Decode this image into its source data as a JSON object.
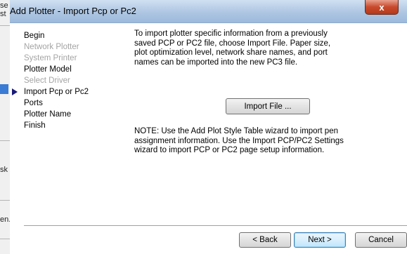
{
  "background_app": {
    "fragments": [
      "se",
      "st",
      "sk",
      "en."
    ]
  },
  "dialog": {
    "title": "Add Plotter - Import Pcp or Pc2",
    "close_label": "x",
    "nav": [
      {
        "label": "Begin",
        "state": "enabled"
      },
      {
        "label": "Network Plotter",
        "state": "disabled"
      },
      {
        "label": "System Printer",
        "state": "disabled"
      },
      {
        "label": "Plotter Model",
        "state": "enabled"
      },
      {
        "label": "Select Driver",
        "state": "disabled"
      },
      {
        "label": "Import Pcp or Pc2",
        "state": "current"
      },
      {
        "label": "Ports",
        "state": "enabled"
      },
      {
        "label": "Plotter Name",
        "state": "enabled"
      },
      {
        "label": "Finish",
        "state": "enabled"
      }
    ],
    "intro_text": "To import plotter specific information from a previously saved PCP or PC2 file, choose Import File. Paper size, plot optimization level, network share names, and port names can be imported into the new PC3 file.",
    "import_button": "Import File ...",
    "note_text": "NOTE: Use the Add Plot Style Table wizard to import pen assignment information. Use the Import PCP/PC2 Settings wizard to import PCP or PC2 page setup information.",
    "buttons": {
      "back": "< Back",
      "next": "Next >",
      "cancel": "Cancel"
    }
  },
  "colors": {
    "titlebar": "#aec6e2",
    "close": "#c84a2c",
    "disabled_text": "#a4a4a4",
    "current_arrow": "#1a1a7a"
  }
}
